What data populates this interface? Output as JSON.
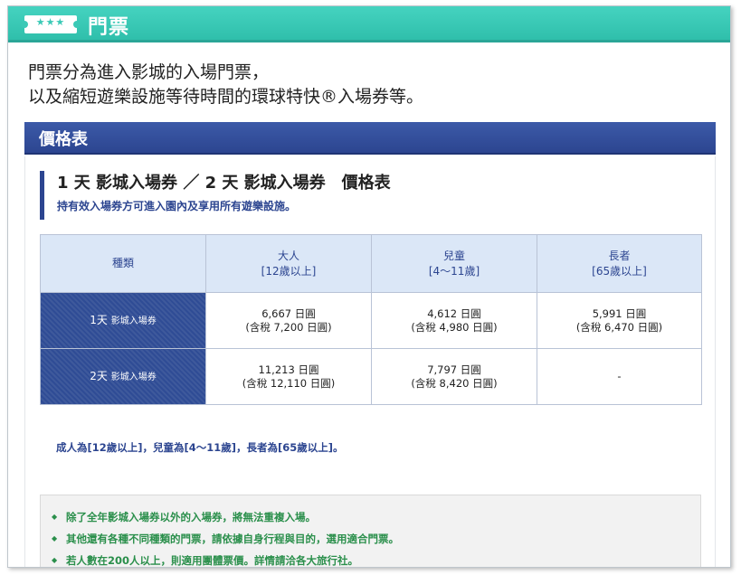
{
  "header": {
    "title": "門票",
    "ticket_stars": "★★★"
  },
  "intro": {
    "line1": "門票分為進入影城的入場門票，",
    "line2": "以及縮短遊樂設施等待時間的環球特快®入場券等。"
  },
  "section": {
    "title": "價格表"
  },
  "subsection": {
    "title": "1 天 影城入場券 ／ 2 天 影城入場券　價格表",
    "note": "持有效入場券方可進入園內及享用所有遊樂設施。"
  },
  "table": {
    "headers": [
      {
        "name": "種類",
        "sub": ""
      },
      {
        "name": "大人",
        "sub": "[12歲以上]"
      },
      {
        "name": "兒童",
        "sub": "[4～11歲]"
      },
      {
        "name": "長者",
        "sub": "[65歲以上]"
      }
    ],
    "rows": [
      {
        "label_big": "1天",
        "label_small": "影城入場券",
        "cells": [
          {
            "price": "6,667 日圓",
            "tax": "(含稅 7,200 日圓)"
          },
          {
            "price": "4,612 日圓",
            "tax": "(含稅 4,980 日圓)"
          },
          {
            "price": "5,991 日圓",
            "tax": "(含稅 6,470 日圓)"
          }
        ]
      },
      {
        "label_big": "2天",
        "label_small": "影城入場券",
        "cells": [
          {
            "price": "11,213 日圓",
            "tax": "(含稅 12,110 日圓)"
          },
          {
            "price": "7,797 日圓",
            "tax": "(含稅 8,420 日圓)"
          },
          {
            "price": "-",
            "tax": ""
          }
        ]
      }
    ]
  },
  "age_note": "成人為[12歲以上]，兒童為[4～11歲]，長者為[65歲以上]。",
  "notes": {
    "bullet": "◆",
    "items": [
      "除了全年影城入場券以外的入場券，將無法重複入場。",
      "其他還有各種不同種類的門票，請依據自身行程與目的，選用適合門票。",
      "若人數在200人以上，則適用團體票價。詳情請洽各大旅行社。"
    ]
  },
  "colors": {
    "header_teal": "#3bc9b6",
    "section_blue": "#2c4590",
    "table_head_bg": "#dbe7f7",
    "note_green": "#2a8f4b"
  }
}
